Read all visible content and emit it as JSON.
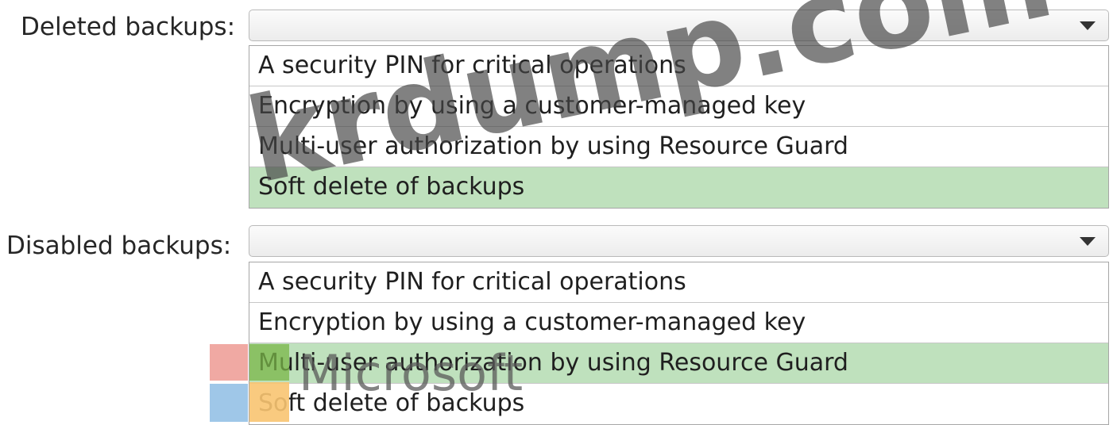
{
  "deleted_backups": {
    "label": "Deleted backups:",
    "selected_value": "",
    "options": [
      {
        "label": "A security PIN for critical operations",
        "selected": false
      },
      {
        "label": "Encryption by using a customer-managed key",
        "selected": false
      },
      {
        "label": "Multi-user authorization by using Resource Guard",
        "selected": false
      },
      {
        "label": "Soft delete of backups",
        "selected": true
      }
    ]
  },
  "disabled_backups": {
    "label": "Disabled backups:",
    "selected_value": "",
    "options": [
      {
        "label": "A security PIN for critical operations",
        "selected": false
      },
      {
        "label": "Encryption by using a customer-managed key",
        "selected": false
      },
      {
        "label": "Multi-user authorization by using Resource Guard",
        "selected": true
      },
      {
        "label": "Soft delete of backups",
        "selected": false
      }
    ]
  },
  "watermark": {
    "text": "krdump.com"
  },
  "overlay": {
    "brand_word": "Microsoft"
  },
  "colors": {
    "selected_option": "#bfe1bd",
    "swatch_red": "#f0a9a3",
    "swatch_blue": "#9fc7e8",
    "logo_green": "#7ab648",
    "logo_yellow": "#f8c471"
  },
  "icons": {
    "dropdown": "triangle-down-icon"
  }
}
